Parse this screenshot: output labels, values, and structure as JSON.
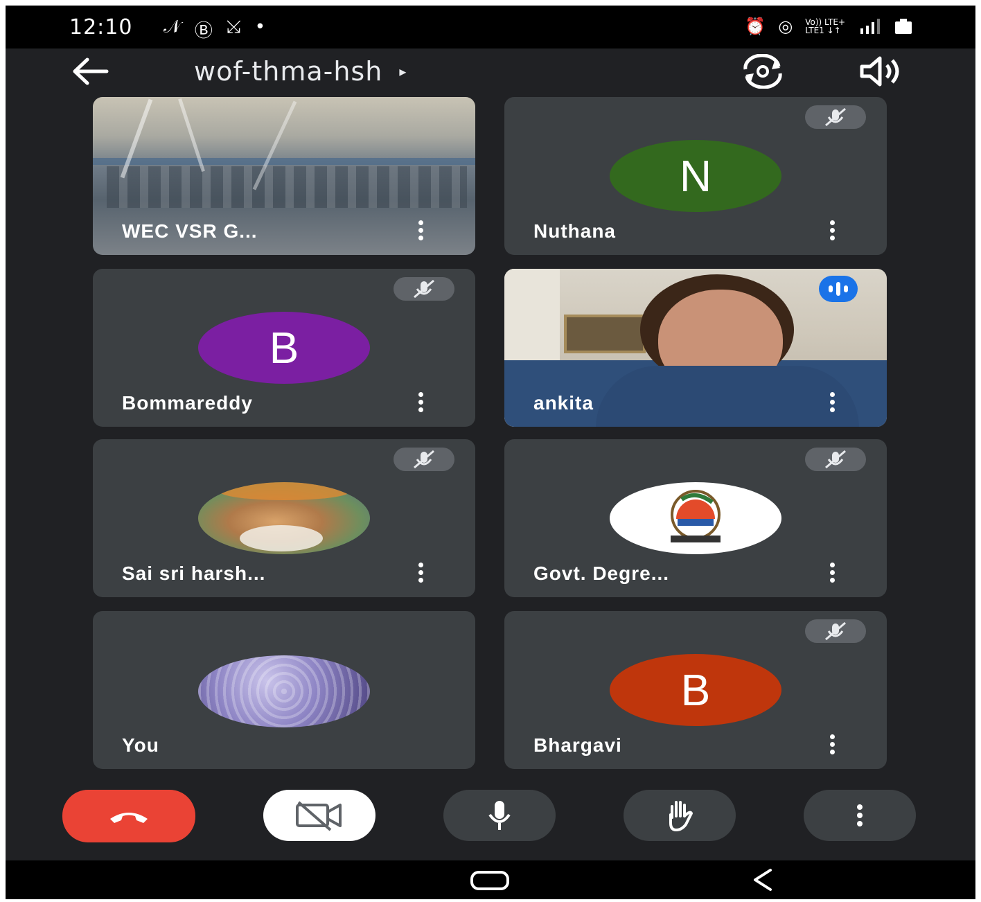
{
  "status_bar": {
    "time": "12:10",
    "left_icons": [
      "signal-n-icon",
      "b-app-icon",
      "missed-call-icon",
      "dot-icon"
    ],
    "right_icons": [
      "alarm-icon",
      "hotspot-icon",
      "volte-icon",
      "signal-bars-icon",
      "battery-icon"
    ],
    "volte_label": "Vo)) LTE+",
    "volte_sub": "LTE1 ↓↑"
  },
  "header": {
    "meeting_code": "wof-thma-hsh",
    "expand_glyph": "▸"
  },
  "participants": [
    {
      "name": "WEC VSR G...",
      "type": "video",
      "muted": false
    },
    {
      "name": "Nuthana",
      "type": "initial",
      "initial": "N",
      "color": "#33691e",
      "muted": true
    },
    {
      "name": "Bommareddy",
      "type": "initial",
      "initial": "B",
      "color": "#7b1fa2",
      "muted": true
    },
    {
      "name": "ankita",
      "type": "video",
      "muted": false,
      "speaking": true
    },
    {
      "name": "Sai sri harsh...",
      "type": "photo",
      "muted": true
    },
    {
      "name": "Govt. Degre...",
      "type": "logo",
      "muted": true
    },
    {
      "name": "You",
      "type": "photo",
      "muted": false
    },
    {
      "name": "Bhargavi",
      "type": "initial",
      "initial": "B",
      "color": "#bf360c",
      "muted": true
    }
  ],
  "controls": [
    "end-call",
    "camera-off",
    "microphone",
    "raise-hand",
    "more-options"
  ],
  "colors": {
    "end_call": "#ea4335",
    "background": "#202124",
    "tile": "#3c4043",
    "speaking_badge": "#1a73e8"
  }
}
